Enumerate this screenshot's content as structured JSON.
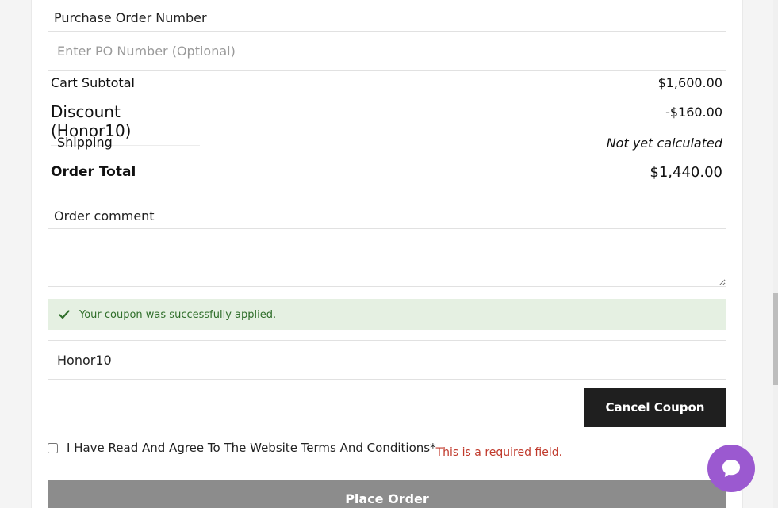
{
  "po": {
    "label": "Purchase Order Number",
    "placeholder": "Enter PO Number (Optional)",
    "value": ""
  },
  "summary": {
    "subtotal_label": "Cart Subtotal",
    "subtotal_value": "$1,600.00",
    "discount_label": "Discount (Honor10)",
    "discount_value": "-$160.00",
    "shipping_label": "Shipping",
    "shipping_value": "Not yet calculated",
    "total_label": "Order Total",
    "total_value": "$1,440.00"
  },
  "comment": {
    "label": "Order comment",
    "value": ""
  },
  "notice": {
    "text": "Your coupon was successfully applied.",
    "icon": "check-icon",
    "bg_color": "#e5f0e2",
    "text_color": "#2f6e2a"
  },
  "coupon": {
    "value": "Honor10",
    "cancel_label": "Cancel Coupon"
  },
  "terms": {
    "text": "I Have Read And Agree To The Website Terms And Conditions",
    "required_mark": "*",
    "error": "This is a required field."
  },
  "place_order_label": "Place Order",
  "chat": {
    "icon": "chat-bubble-icon",
    "color": "#9b59d0"
  }
}
